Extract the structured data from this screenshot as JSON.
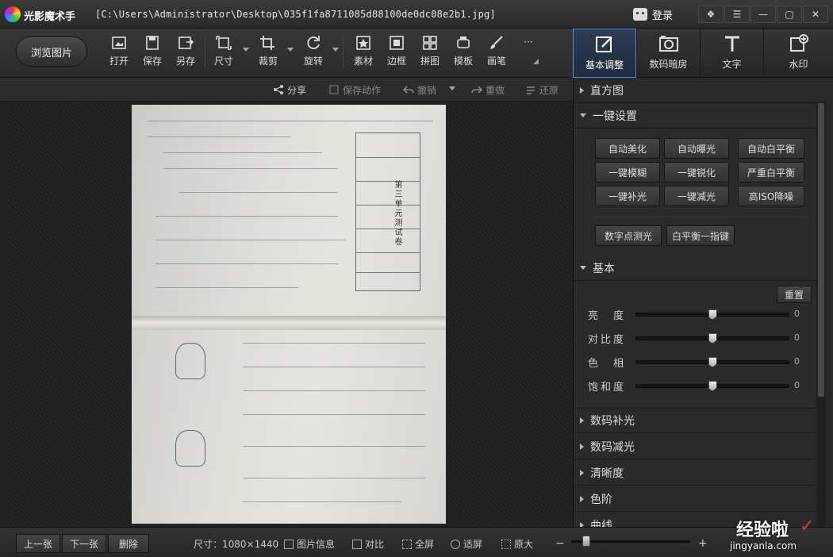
{
  "title_bar": {
    "app_name": "光影魔术手",
    "file_path": "[C:\\Users\\Administrator\\Desktop\\035f1fa8711085d88100de0dc08e2b1.jpg]",
    "login_label": "登录",
    "buttons": [
      "skin-icon",
      "menu-icon",
      "minimize-icon",
      "maximize-icon",
      "close-icon"
    ]
  },
  "toolbar": {
    "browse_label": "浏览图片",
    "tools": [
      {
        "label": "打开",
        "icon": "open-icon"
      },
      {
        "label": "保存",
        "icon": "save-icon"
      },
      {
        "label": "另存",
        "icon": "save-as-icon"
      },
      {
        "label": "尺寸",
        "icon": "resize-icon"
      },
      {
        "label": "裁剪",
        "icon": "crop-icon"
      },
      {
        "label": "旋转",
        "icon": "rotate-icon"
      },
      {
        "label": "素材",
        "icon": "material-icon"
      },
      {
        "label": "边框",
        "icon": "frame-icon"
      },
      {
        "label": "拼图",
        "icon": "collage-icon"
      },
      {
        "label": "模板",
        "icon": "template-icon"
      },
      {
        "label": "画笔",
        "icon": "brush-icon"
      }
    ],
    "more_label": "···"
  },
  "panel_tabs": [
    {
      "label": "基本调整",
      "icon": "adjust-icon",
      "active": true
    },
    {
      "label": "数码暗房",
      "icon": "darkroom-icon",
      "active": false
    },
    {
      "label": "文字",
      "icon": "text-icon",
      "active": false
    },
    {
      "label": "水印",
      "icon": "watermark-icon",
      "active": false
    }
  ],
  "actions": {
    "share": "分享",
    "save_action": "保存动作",
    "undo": "撤销",
    "redo": "重做",
    "restore": "还原"
  },
  "panel": {
    "histogram": "直方图",
    "one_click": "一键设置",
    "one_click_buttons": [
      "自动美化",
      "自动曝光",
      "自动白平衡",
      "一键模糊",
      "一键锐化",
      "严重白平衡",
      "一键补光",
      "一键减光",
      "高ISO降噪"
    ],
    "extra_buttons": [
      "数字点测光",
      "白平衡一指键"
    ],
    "basic": "基本",
    "reset": "重置",
    "sliders": [
      {
        "label": "亮　度",
        "value": "0",
        "level": 0.5
      },
      {
        "label": "对比度",
        "value": "0",
        "level": 0.5
      },
      {
        "label": "色　相",
        "value": "0",
        "level": 0.5
      },
      {
        "label": "饱和度",
        "value": "0",
        "level": 0.5
      }
    ],
    "collapsed_sections": [
      "数码补光",
      "数码减光",
      "清晰度",
      "色阶",
      "曲线"
    ]
  },
  "status": {
    "prev": "上一张",
    "next": "下一张",
    "delete": "删除",
    "size_text": "尺寸：1080×1440",
    "info": "图片信息",
    "compare": "对比",
    "fullscreen": "全屏",
    "fit": "适屏",
    "original": "原大",
    "zoom_out": "−",
    "zoom_in": "+"
  },
  "watermark": {
    "main": "经验啦",
    "sub": "jingyanla.com"
  },
  "photo": {
    "doc_title": "第三单元测试卷"
  },
  "colors": {
    "accent": "#4f8fdc",
    "background": "#232323"
  }
}
